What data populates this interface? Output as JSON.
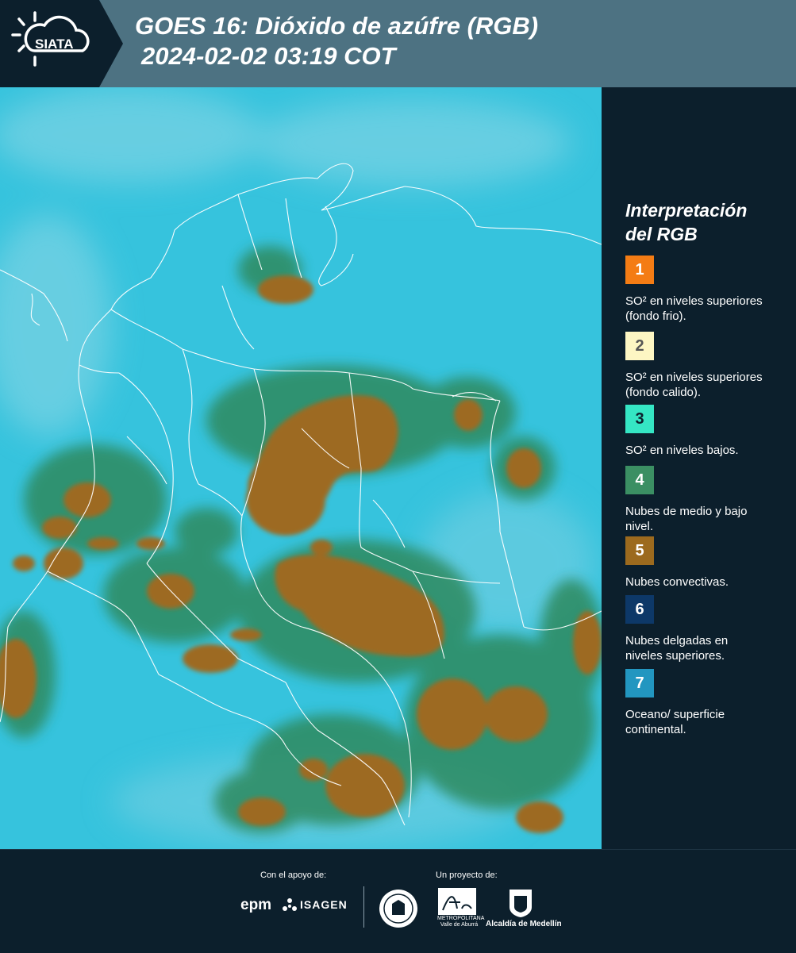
{
  "header": {
    "logo_text": "SIATA",
    "title_line1": "GOES 16: Dióxido de azúfre (RGB)",
    "title_line2": "2024-02-02 03:19 COT"
  },
  "legend": {
    "title_line1": "Interpretación",
    "title_line2": "del RGB",
    "items": [
      {
        "num": "1",
        "color": "#f47c14",
        "text": "SO² en niveles superiores (fondo frio)."
      },
      {
        "num": "2",
        "color": "#fdf6c3",
        "text": "SO² en niveles superiores (fondo calido)."
      },
      {
        "num": "3",
        "color": "#35e6c4",
        "text": "SO² en niveles bajos."
      },
      {
        "num": "4",
        "color": "#3b8f63",
        "text": "Nubes de medio y bajo nivel."
      },
      {
        "num": "5",
        "color": "#9c6a1e",
        "text": "Nubes convectivas."
      },
      {
        "num": "6",
        "color": "#0d3868",
        "text": "Nubes delgadas en niveles superiores."
      },
      {
        "num": "7",
        "color": "#2296c0",
        "text": "Oceano/ superficie continental."
      }
    ]
  },
  "footer": {
    "support_label": "Con el apoyo de:",
    "project_label": "Un proyecto de:",
    "epm": "epm",
    "isagen": "ISAGEN",
    "area_name": "METROPOLITANA Valle de Aburrá",
    "alcaldia": "Alcaldía de Medellín"
  },
  "colors": {
    "header_bg": "#4d7282",
    "panel_bg": "#0c1f2c",
    "map_base": "#35c2dc",
    "cloud": "#9c6a1e"
  }
}
